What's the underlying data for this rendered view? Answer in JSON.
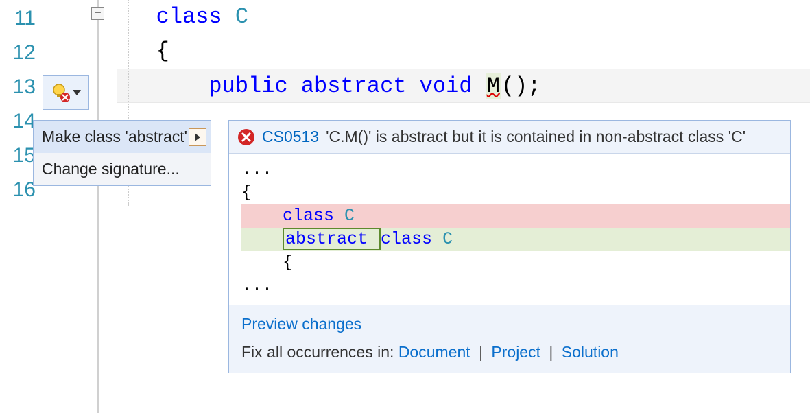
{
  "lines": {
    "n11": "11",
    "n12": "12",
    "n13": "13",
    "n14": "14",
    "n15": "15",
    "n16": "16"
  },
  "fold_box": "−",
  "code": {
    "l11_kw": "class ",
    "l11_type": "C",
    "l12": "{",
    "l13_kw1": "public ",
    "l13_kw2": "abstract ",
    "l13_kw3": "void ",
    "l13_method": "M",
    "l13_rest": "();"
  },
  "quick_actions": {
    "item1": "Make class 'abstract'",
    "item2": "Change signature..."
  },
  "error": {
    "code": "CS0513",
    "message": "'C.M()' is abstract but it is contained in non-abstract class 'C'"
  },
  "diff": {
    "ellipsis": "...",
    "brace_open": "{",
    "removed_indent": "    ",
    "removed_kw": "class ",
    "removed_type": "C",
    "added_indent": "    ",
    "added_new": "abstract ",
    "added_kw": "class ",
    "added_type": "C",
    "brace_open2": "    {"
  },
  "footer": {
    "preview": "Preview changes",
    "fix_label": "Fix all occurrences in: ",
    "doc": "Document",
    "project": "Project",
    "solution": "Solution",
    "sep": " | "
  }
}
